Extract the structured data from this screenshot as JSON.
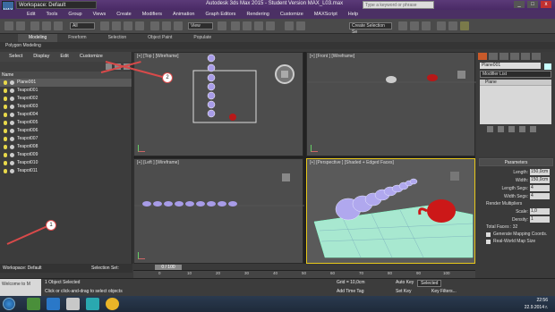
{
  "titlebar": {
    "workspace": "Workspace: Default",
    "title": "Autodesk 3ds Max 2015 - Student Version   MAX_L03.max",
    "search_placeholder": "Type a keyword or phrase",
    "min": "_",
    "max": "□",
    "close": "x"
  },
  "menu": [
    "Edit",
    "Tools",
    "Group",
    "Views",
    "Create",
    "Modifiers",
    "Animation",
    "Graph Editors",
    "Rendering",
    "Customize",
    "MAXScript",
    "Help"
  ],
  "toolbar": {
    "filter": "All",
    "refcoord": "View",
    "selset": "Create Selection Se"
  },
  "ribbon": [
    "Modeling",
    "Freeform",
    "Selection",
    "Object Paint",
    "Populate"
  ],
  "ribbon_sub": "Polygon Modeling",
  "explorer": {
    "menu": [
      "Select",
      "Display",
      "Edit",
      "Customize"
    ],
    "header": "Name",
    "items": [
      "Plane001",
      "Teapot001",
      "Teapot002",
      "Teapot003",
      "Teapot004",
      "Teapot005",
      "Teapot006",
      "Teapot007",
      "Teapot008",
      "Teapot009",
      "Teapot010",
      "Teapot011"
    ],
    "footer_ws": "Workspace: Default",
    "footer_sel": "Selection Set:"
  },
  "viewports": {
    "top": "[+] [Top ] [Wireframe]",
    "front": "[+] [Front ] [Wireframe]",
    "left": "[+] [Left ] [Wireframe]",
    "persp": "[+] [Perspective ] [Shaded + Edged Faces]"
  },
  "command": {
    "name": "Plane001",
    "modlist": "Modifier List",
    "stack": [
      "Plane"
    ],
    "params_title": "Parameters",
    "length_label": "Length:",
    "length": "150,0cm",
    "width_label": "Width:",
    "width": "150,0cm",
    "lsegs_label": "Length Segs:",
    "lsegs": "4",
    "wsegs_label": "Width Segs:",
    "wsegs": "4",
    "rm_label": "Render Multipliers",
    "scale_label": "Scale:",
    "scale": "1,0",
    "density_label": "Density:",
    "density": "1",
    "faces": "Total Faces : 32",
    "gen_map": "Generate Mapping Coords.",
    "real_world": "Real-World Map Size"
  },
  "timeline": {
    "slider": "0 / 100",
    "ticks": [
      "0",
      "10",
      "20",
      "30",
      "40",
      "50",
      "60",
      "70",
      "80",
      "90",
      "100"
    ]
  },
  "status": {
    "maxscript": "Welcome to M",
    "selected": "1 Object Selected",
    "prompt": "Click or click-and-drag to select objects",
    "grid": "Grid = 10,0cm",
    "add_time_tag": "Add Time Tag",
    "autokey": "Auto Key",
    "autokey_val": "Selected",
    "setkey": "Set Key",
    "keyfilters": "Key Filters..."
  },
  "taskbar": {
    "time": "22:56",
    "date": "22.9.2014 г."
  },
  "annotations": [
    "1",
    "2"
  ]
}
